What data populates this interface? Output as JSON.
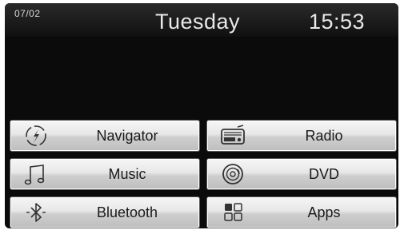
{
  "status": {
    "date": "07/02",
    "day": "Tuesday",
    "time": "15:53"
  },
  "menu": {
    "navigator": "Navigator",
    "radio": "Radio",
    "music": "Music",
    "dvd": "DVD",
    "bluetooth": "Bluetooth",
    "apps": "Apps"
  },
  "icons": {
    "navigator": "compass-icon",
    "radio": "radio-icon",
    "music": "music-note-icon",
    "dvd": "disc-icon",
    "bluetooth": "bluetooth-icon",
    "apps": "apps-grid-icon"
  }
}
